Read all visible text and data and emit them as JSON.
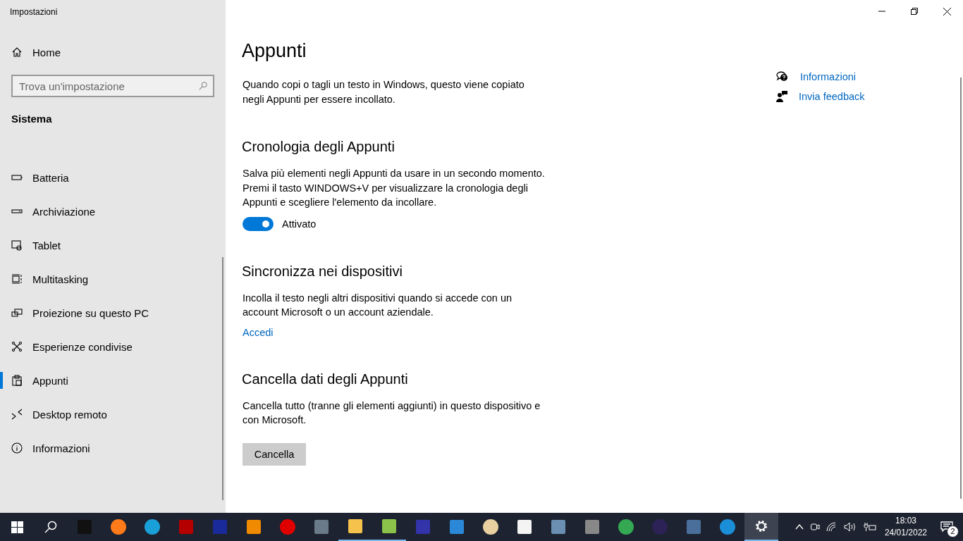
{
  "window": {
    "title": "Impostazioni"
  },
  "sidebar": {
    "home": "Home",
    "search": {
      "placeholder": "Trova un'impostazione"
    },
    "section": "Sistema",
    "items": [
      {
        "label": "Batteria",
        "kind": "battery",
        "selected": false
      },
      {
        "label": "Archiviazione",
        "kind": "storage",
        "selected": false
      },
      {
        "label": "Tablet",
        "kind": "tablet",
        "selected": false
      },
      {
        "label": "Multitasking",
        "kind": "multitasking",
        "selected": false
      },
      {
        "label": "Proiezione su questo PC",
        "kind": "projection",
        "selected": false
      },
      {
        "label": "Esperienze condivise",
        "kind": "shared",
        "selected": false
      },
      {
        "label": "Appunti",
        "kind": "clipboard",
        "selected": true
      },
      {
        "label": "Desktop remoto",
        "kind": "remote",
        "selected": false
      },
      {
        "label": "Informazioni",
        "kind": "info",
        "selected": false
      }
    ]
  },
  "page": {
    "title": "Appunti",
    "intro": "Quando copi o tagli un testo in Windows, questo viene copiato negli Appunti per essere incollato.",
    "sections": [
      {
        "kind": "toggle",
        "heading": "Cronologia degli Appunti",
        "text": "Salva più elementi negli Appunti da usare in un secondo momento. Premi il tasto WINDOWS+V per visualizzare la cronologia degli Appunti e scegliere l'elemento da incollare.",
        "on": true,
        "state_label": "Attivato"
      },
      {
        "kind": "link",
        "heading": "Sincronizza nei dispositivi",
        "text": "Incolla il testo negli altri dispositivi quando si accede con un account Microsoft o un account aziendale.",
        "link": "Accedi"
      },
      {
        "kind": "button",
        "heading": "Cancella dati degli Appunti",
        "text": "Cancella tutto (tranne gli elementi aggiunti) in questo dispositivo e con Microsoft.",
        "button": "Cancella"
      }
    ]
  },
  "help_links": [
    {
      "label": "Informazioni",
      "kind": "help"
    },
    {
      "label": "Invia feedback",
      "kind": "feedback"
    }
  ],
  "taskbar": {
    "apps": [
      {
        "kind": "terminal",
        "open": false,
        "selected": false
      },
      {
        "kind": "firefox",
        "open": false,
        "selected": false
      },
      {
        "kind": "edge",
        "open": false,
        "selected": false
      },
      {
        "kind": "filezilla",
        "open": false,
        "selected": false
      },
      {
        "kind": "audio",
        "open": false,
        "selected": false
      },
      {
        "kind": "cone",
        "open": false,
        "selected": false
      },
      {
        "kind": "record",
        "open": false,
        "selected": false
      },
      {
        "kind": "calculator",
        "open": false,
        "selected": false
      },
      {
        "kind": "folder",
        "open": true,
        "selected": false
      },
      {
        "kind": "notepad",
        "open": true,
        "selected": false
      },
      {
        "kind": "floppy",
        "open": false,
        "selected": false
      },
      {
        "kind": "card",
        "open": false,
        "selected": false
      },
      {
        "kind": "palette",
        "open": false,
        "selected": false
      },
      {
        "kind": "file",
        "open": false,
        "selected": false
      },
      {
        "kind": "photos",
        "open": false,
        "selected": false
      },
      {
        "kind": "mic",
        "open": false,
        "selected": false
      },
      {
        "kind": "chrome",
        "open": false,
        "selected": false
      },
      {
        "kind": "eclipse",
        "open": false,
        "selected": false
      },
      {
        "kind": "writer",
        "open": false,
        "selected": false
      },
      {
        "kind": "birds",
        "open": false,
        "selected": false
      },
      {
        "kind": "settings",
        "open": true,
        "selected": true
      }
    ],
    "time": "18:03",
    "date": "24/01/2022",
    "notifications": "2"
  }
}
